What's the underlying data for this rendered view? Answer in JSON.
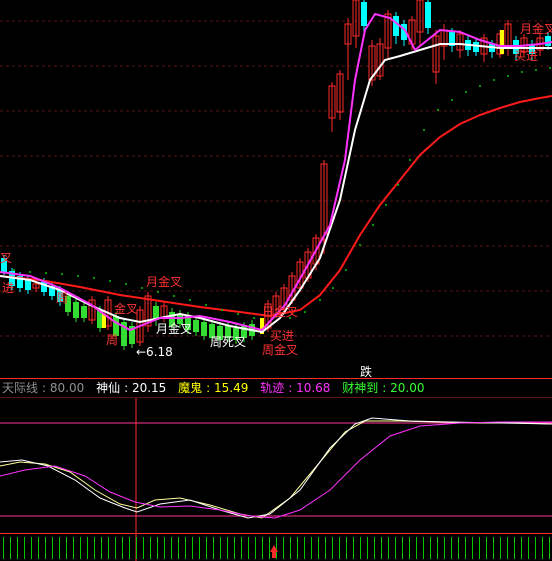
{
  "chart_data": [
    {
      "type": "candlestick",
      "panel": "main",
      "colors": {
        "up": "#ff2a2a",
        "down": "#00ffff",
        "ma_white": "#ffffff",
        "ma_magenta": "#ff33ff",
        "ma_red": "#ff1a1a",
        "dots": "#00c800",
        "signal": "#ffff00",
        "text_red": "#ff3333",
        "text_white": "#ffffff"
      },
      "annotations": [
        {
          "id": "a1",
          "text": "叉",
          "color": "red"
        },
        {
          "id": "a2",
          "text": "进",
          "color": "red"
        },
        {
          "id": "a3",
          "text": "周",
          "color": "red"
        },
        {
          "id": "a4",
          "text": "月金叉",
          "color": "red"
        },
        {
          "id": "a5",
          "text": "金叉",
          "color": "red"
        },
        {
          "id": "a6",
          "text": "月金叉",
          "color": "white"
        },
        {
          "id": "a7",
          "text": "周",
          "color": "red"
        },
        {
          "id": "a8",
          "text": "周死叉",
          "color": "white"
        },
        {
          "id": "a9",
          "text": "日金叉",
          "color": "red"
        },
        {
          "id": "a10",
          "text": "买进",
          "color": "red"
        },
        {
          "id": "a11",
          "text": "周金叉",
          "color": "red"
        },
        {
          "id": "a12",
          "text": "←6.18",
          "color": "white"
        },
        {
          "id": "a13",
          "text": "跌",
          "color": "white"
        },
        {
          "id": "a14",
          "text": "月金叉",
          "color": "red"
        },
        {
          "id": "a15",
          "text": "买进",
          "color": "red"
        }
      ]
    },
    {
      "type": "line",
      "panel": "indicator",
      "legend": [
        {
          "name": "天际线",
          "value": "80.00",
          "color": "#909090"
        },
        {
          "name": "神仙",
          "value": "20.15",
          "color": "#ffffff"
        },
        {
          "name": "魔鬼",
          "value": "15.49",
          "color": "#ffff00"
        },
        {
          "name": "轨迹",
          "value": "10.68",
          "color": "#ff33ff"
        },
        {
          "name": "财神到",
          "value": "20.00",
          "color": "#33ff33"
        }
      ],
      "colors": {
        "line1": "#ffff99",
        "line2": "#ffffff",
        "line3": "#ff33ff",
        "hline": "#ff3399",
        "divider": "#ff2a2a",
        "crosshair": "#ff3333",
        "bars": "#00c800",
        "arrow": "#ff2a2a"
      }
    }
  ]
}
